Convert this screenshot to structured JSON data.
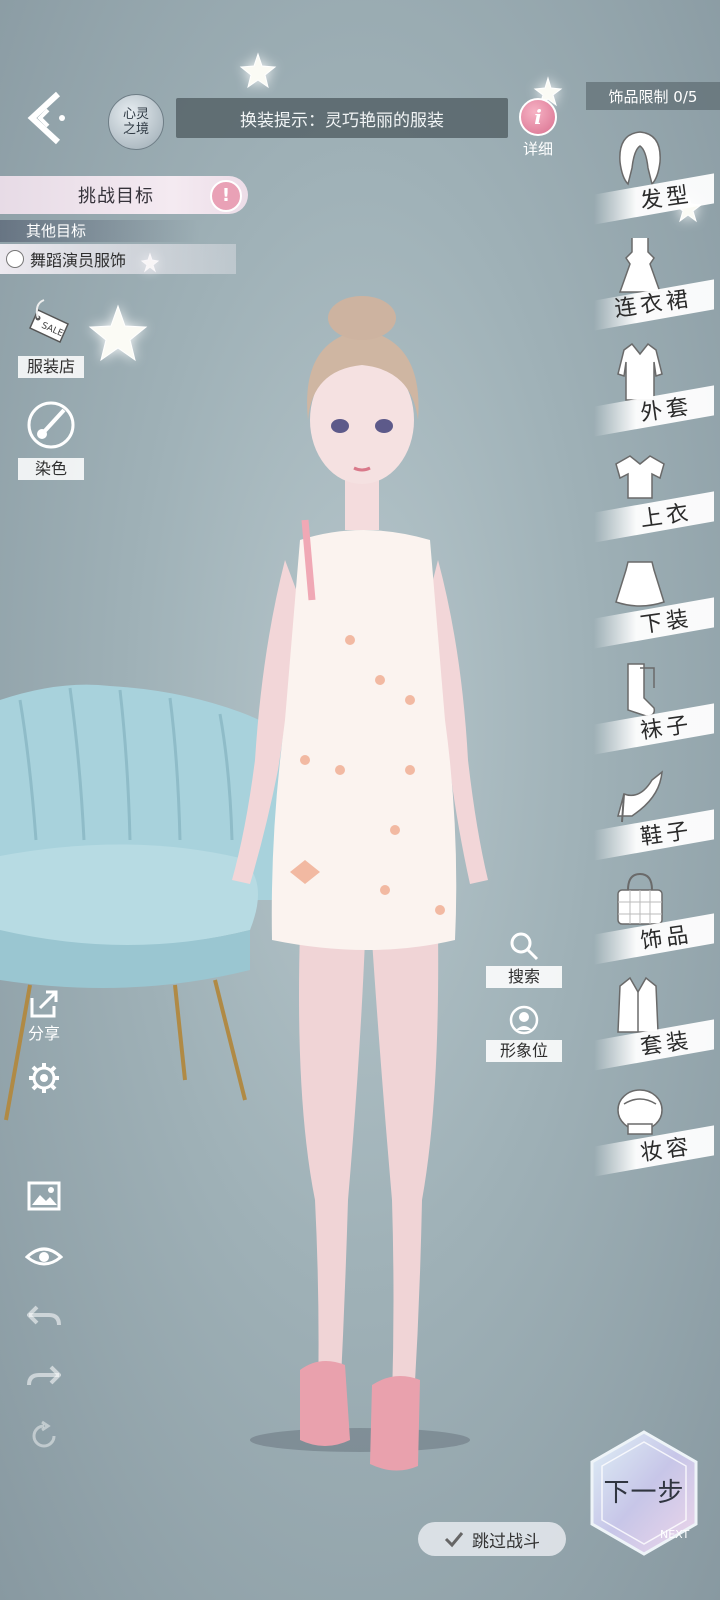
{
  "top_bar": {
    "logo_line1": "心灵",
    "logo_line2": "之境",
    "hint": "换装提示：灵巧艳丽的服装",
    "detail_label": "详细",
    "accessory_limit": "饰品限制 0/5"
  },
  "challenge": {
    "title": "挑战目标",
    "other_header": "其他目标",
    "other_item": "舞蹈演员服饰"
  },
  "left_tools": {
    "shop_label": "服装店",
    "shop_tag": "SALE",
    "dye_label": "染色",
    "share_label": "分享"
  },
  "categories": [
    {
      "label": "发型",
      "icon": "hair-icon"
    },
    {
      "label": "连衣裙",
      "icon": "dress-icon"
    },
    {
      "label": "外套",
      "icon": "coat-icon"
    },
    {
      "label": "上衣",
      "icon": "top-icon"
    },
    {
      "label": "下装",
      "icon": "skirt-icon"
    },
    {
      "label": "袜子",
      "icon": "socks-icon"
    },
    {
      "label": "鞋子",
      "icon": "heel-icon"
    },
    {
      "label": "饰品",
      "icon": "bag-icon"
    },
    {
      "label": "套装",
      "icon": "suit-icon"
    },
    {
      "label": "妆容",
      "icon": "makeup-icon"
    }
  ],
  "search": {
    "label": "搜索"
  },
  "look_slot": {
    "label": "形象位"
  },
  "next": {
    "label": "下一步",
    "sub": "NEXT"
  },
  "skip": {
    "label": "跳过战斗"
  }
}
